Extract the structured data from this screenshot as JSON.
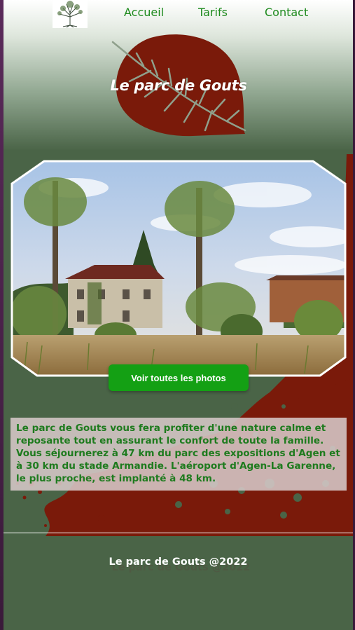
{
  "nav": {
    "logo_icon": "tree-logo-icon",
    "links": [
      "Accueil",
      "Tarifs",
      "Contact"
    ]
  },
  "hero": {
    "title": "Le parc de Gouts",
    "leaf_icon": "leaf-icon"
  },
  "gallery": {
    "photo_alt": "house-garden-photo",
    "button_label": "Voir toutes les photos"
  },
  "description": {
    "text": "Le parc de Gouts vous fera profiter d'une nature calme et reposante tout en assurant le confort de toute la famille. Vous séjournerez à 47 km du parc des expositions d'Agen et à 30 km du stade Armandie. L'aéroport d'Agen-La Garenne, le plus proche, est implanté à 48 km."
  },
  "footer": {
    "text": "Le parc de Gouts @2022"
  },
  "colors": {
    "accent_green": "#1d8a1d",
    "button_green": "#14a014",
    "leaf_red": "#7a1a0a",
    "bg_green": "#4a6447"
  }
}
